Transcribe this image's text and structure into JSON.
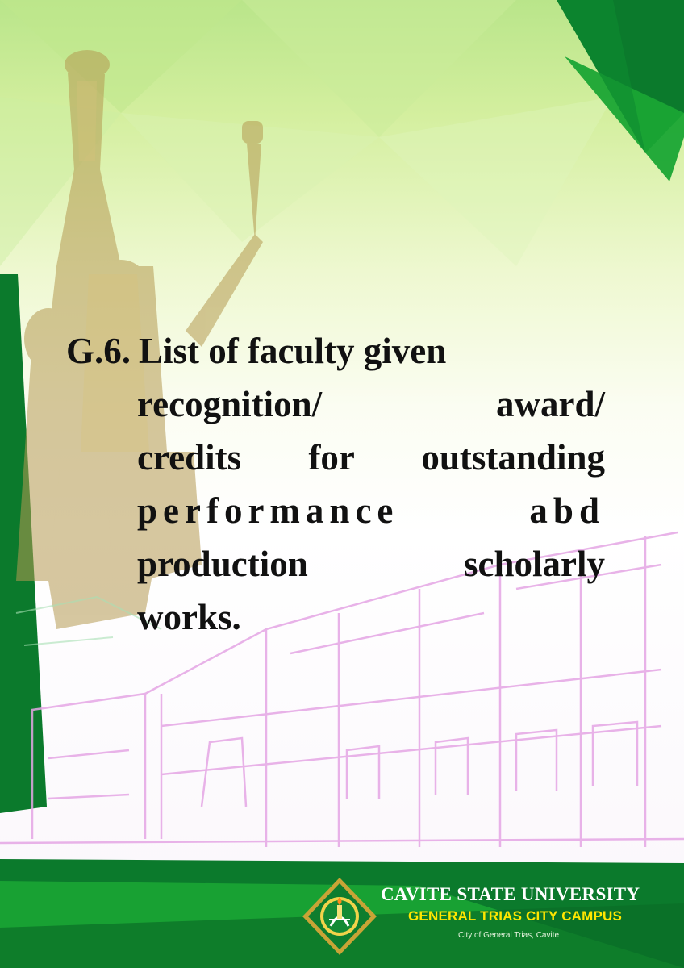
{
  "title": {
    "number": "G.6.",
    "lines": [
      "List of faculty given",
      "recognition/ award/",
      "credits for outstanding",
      "performance abd",
      "production scholarly",
      "works."
    ]
  },
  "brand": {
    "university": "CAVITE STATE UNIVERSITY",
    "campus": "GENERAL TRIAS CITY CAMPUS",
    "city": "City of General Trias, Cavite"
  },
  "colors": {
    "dark_green": "#0b7a2c",
    "bright_green": "#19a533",
    "light_green": "#c4ea92",
    "gold": "#ffe600",
    "outline_pink": "#e6a8e6"
  },
  "icons": [
    "university-seal-icon",
    "monument-statue-graphic",
    "building-sketch-graphic"
  ]
}
